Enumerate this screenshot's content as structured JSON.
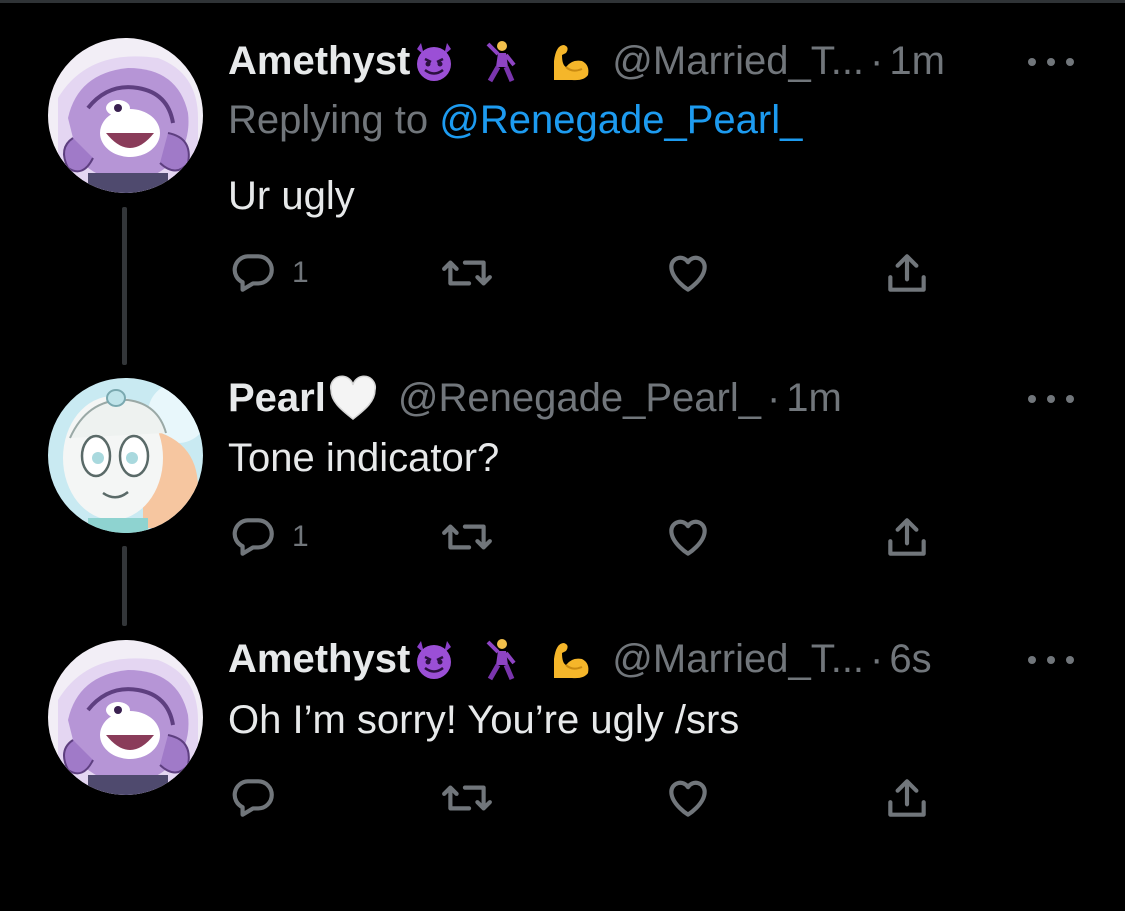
{
  "tweets": [
    {
      "name": "Amethyst",
      "handle": "@Married_T...",
      "separator": "·",
      "time": "1m",
      "reply_prefix": "Replying to",
      "reply_mention": "@Renegade_Pearl_",
      "text": "Ur ugly",
      "reply_count": "1",
      "emojis": [
        "smiling-imp-emoji",
        "man-dancing-emoji",
        "flexed-biceps-emoji"
      ]
    },
    {
      "name": "Pearl",
      "handle": "@Renegade_Pearl_",
      "separator": "·",
      "time": "1m",
      "text": "Tone indicator?",
      "reply_count": "1",
      "emojis": [
        "white-heart-emoji"
      ]
    },
    {
      "name": "Amethyst",
      "handle": "@Married_T...",
      "separator": "·",
      "time": "6s",
      "text": "Oh I’m sorry! You’re ugly /srs",
      "reply_count": "",
      "emojis": [
        "smiling-imp-emoji",
        "man-dancing-emoji",
        "flexed-biceps-emoji"
      ]
    }
  ],
  "colors": {
    "background": "#000000",
    "text": "#e7e9ea",
    "muted": "#71767b",
    "link": "#1d9bf0",
    "thread_line": "#333639"
  },
  "icons": [
    "reply-icon",
    "retweet-icon",
    "like-icon",
    "share-icon",
    "more-icon"
  ]
}
